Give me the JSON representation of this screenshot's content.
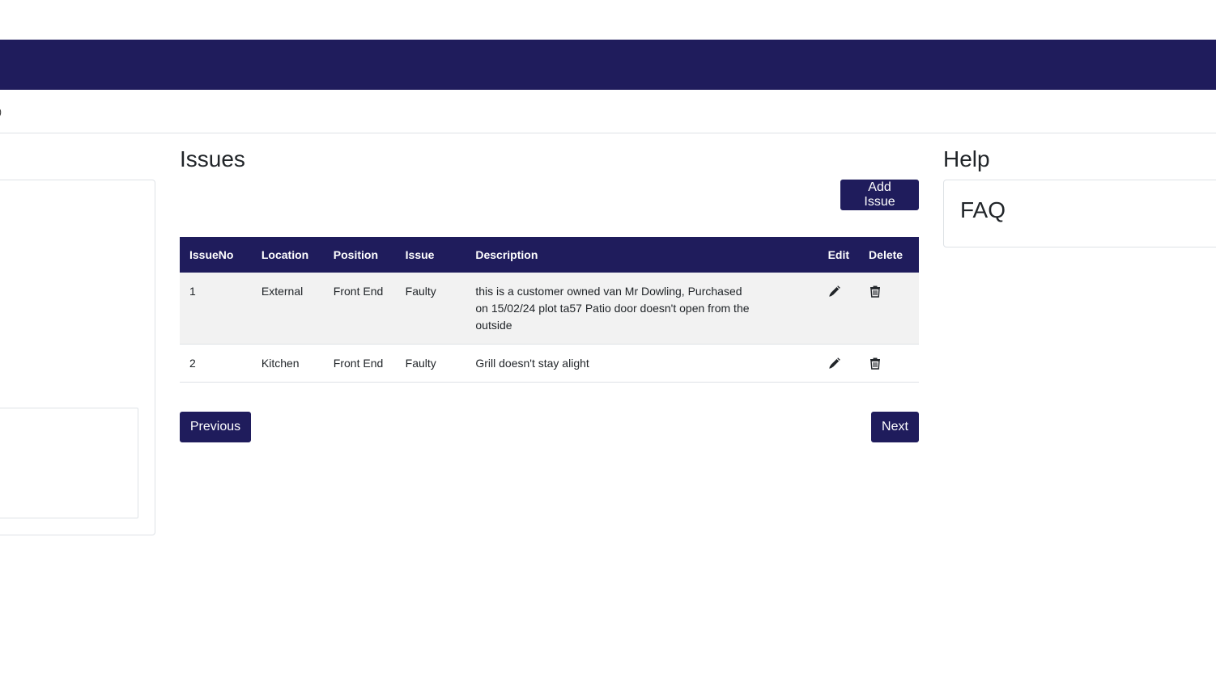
{
  "breadcrumb": {
    "text": ")"
  },
  "issues": {
    "title": "Issues",
    "add_label": "Add Issue",
    "columns": [
      "IssueNo",
      "Location",
      "Position",
      "Issue",
      "Description",
      "Edit",
      "Delete"
    ],
    "rows": [
      {
        "no": "1",
        "location": "External",
        "position": "Front End",
        "issue": "Faulty",
        "description": "this is a customer owned van Mr Dowling, Purchased on 15/02/24 plot ta57 Patio door doesn't open from the outside"
      },
      {
        "no": "2",
        "location": "Kitchen",
        "position": "Front End",
        "issue": "Faulty",
        "description": "Grill doesn't stay alight"
      }
    ],
    "prev_label": "Previous",
    "next_label": "Next"
  },
  "help": {
    "title": "Help",
    "faq_title": "FAQ"
  },
  "colors": {
    "primary": "#1f1c5c",
    "row_stripe": "#f2f2f2",
    "border": "#dee2e6"
  },
  "icons": {
    "edit": "pencil-icon",
    "delete": "trash-icon"
  }
}
